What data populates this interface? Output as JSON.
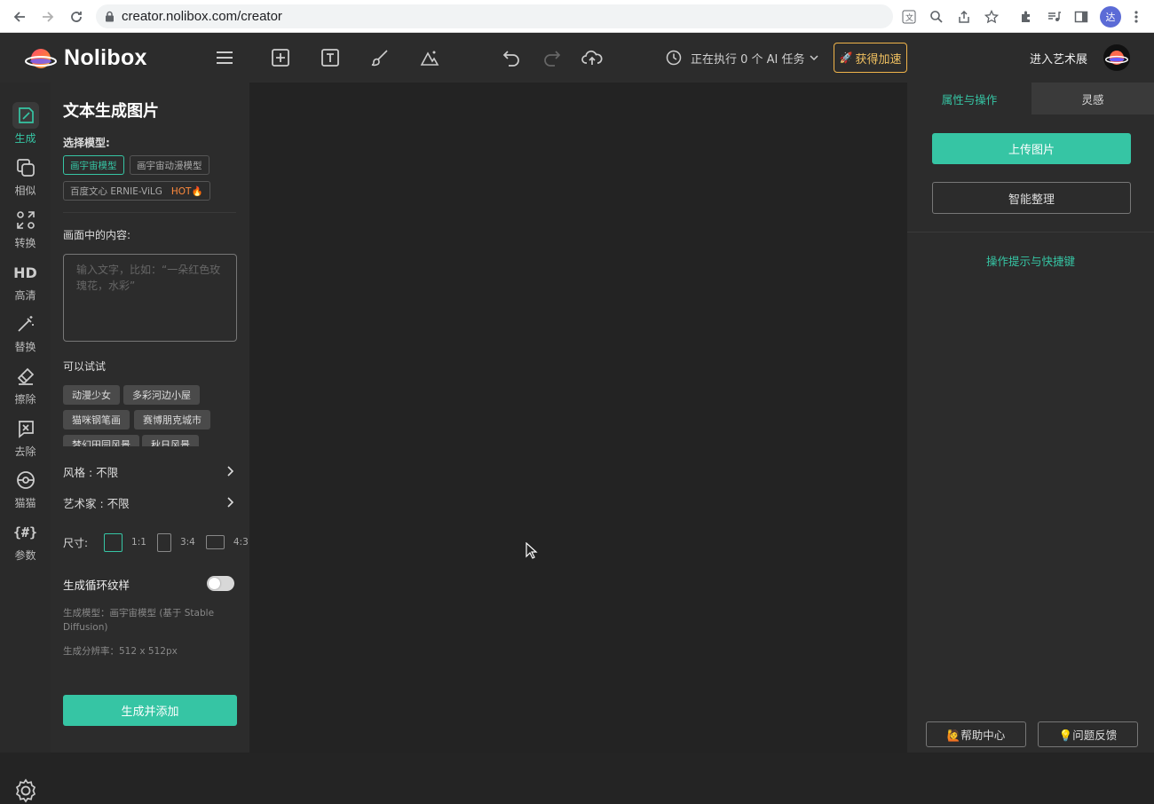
{
  "browser": {
    "url": "creator.nolibox.com/creator",
    "profile_initial": "达"
  },
  "header": {
    "app_name": "Nolibox",
    "task_status": "正在执行 0 个 AI 任务",
    "speed_button": "获得加速",
    "exhibit_link": "进入艺术展"
  },
  "rail": [
    {
      "icon": "brush-icon",
      "label": "生成",
      "active": true
    },
    {
      "icon": "copy-icon",
      "label": "相似"
    },
    {
      "icon": "transform-icon",
      "label": "转换"
    },
    {
      "icon": "hd-icon",
      "label": "高清"
    },
    {
      "icon": "magic-wand-icon",
      "label": "替换"
    },
    {
      "icon": "eraser-icon",
      "label": "擦除"
    },
    {
      "icon": "remove-icon",
      "label": "去除"
    },
    {
      "icon": "cat-icon",
      "label": "猫猫"
    },
    {
      "icon": "params-icon",
      "label": "参数"
    }
  ],
  "panel": {
    "title": "文本生成图片",
    "model_label": "选择模型:",
    "models": [
      "画宇宙模型",
      "画宇宙动漫模型",
      "百度文心 ERNIE-ViLG"
    ],
    "hot": "HOT🔥",
    "content_label": "画面中的内容:",
    "prompt_placeholder": "输入文字，比如：“一朵红色玫瑰花，水彩”",
    "try_label": "可以试试",
    "suggestions": [
      "动漫少女",
      "多彩河边小屋",
      "猫咪钢笔画",
      "赛博朋克城市",
      "梦幻田园风景",
      "秋日风景"
    ],
    "style_row": "风格 : 不限",
    "artist_row": "艺术家 : 不限",
    "size_label": "尺寸:",
    "sizes": [
      "1:1",
      "3:4",
      "4:3"
    ],
    "loop_label": "生成循环纹样",
    "loop_on": false,
    "model_info": "生成模型：画宇宙模型 (基于 Stable Diffusion)",
    "resolution_info": "生成分辨率：512 x 512px",
    "generate_button": "生成并添加"
  },
  "right": {
    "tab_props": "属性与操作",
    "tab_inspiration": "灵感",
    "upload_button": "上传图片",
    "organize_button": "智能整理",
    "hints_link": "操作提示与快捷键",
    "help_button": "🙋帮助中心",
    "feedback_button": "💡问题反馈"
  },
  "colors": {
    "accent": "#36c5a4",
    "speed": "#f0b44a"
  }
}
